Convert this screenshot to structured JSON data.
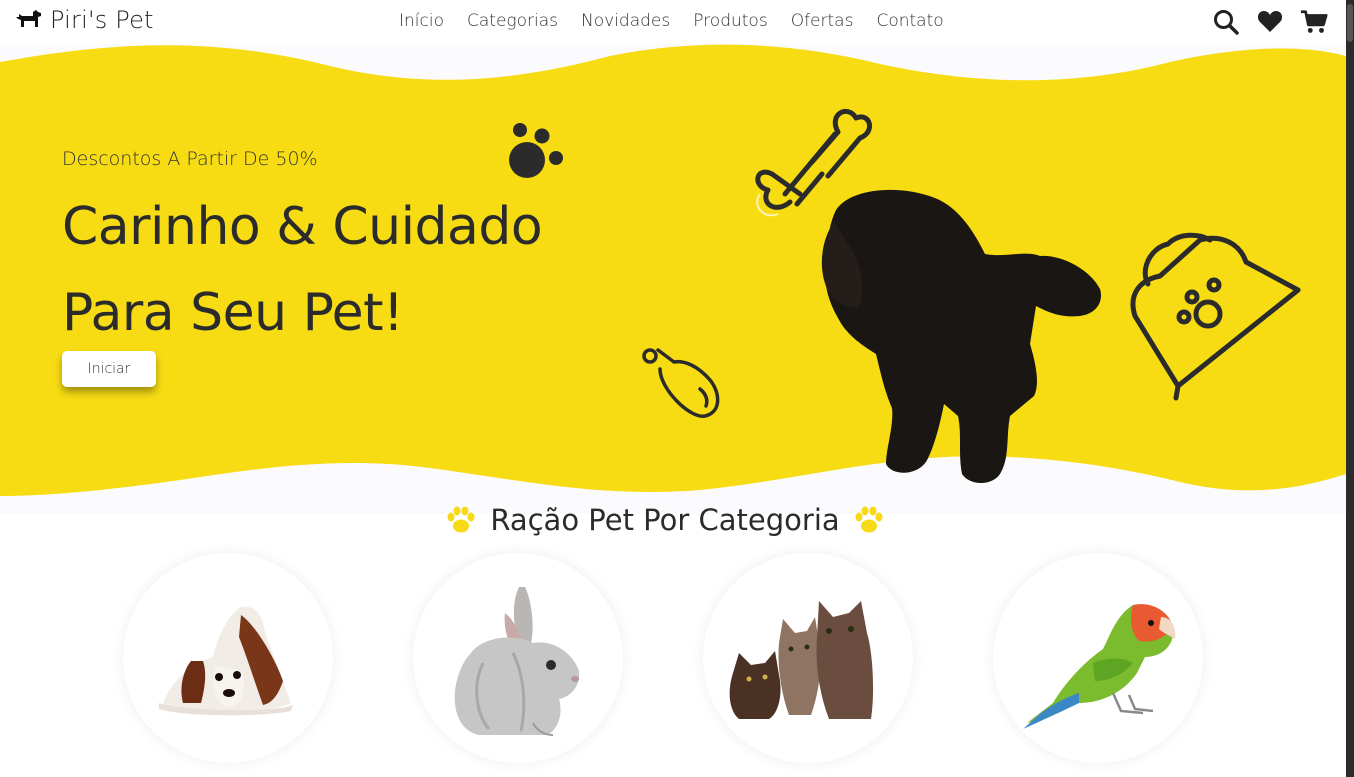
{
  "brand": {
    "name": "Piri's Pet",
    "icon": "dog-icon"
  },
  "nav": [
    "Início",
    "Categorias",
    "Novidades",
    "Produtos",
    "Ofertas",
    "Contato"
  ],
  "header_icons": [
    "search-icon",
    "heart-icon",
    "cart-icon"
  ],
  "hero": {
    "subtitle": "Descontos A Partir De 50%",
    "title_line1": "Carinho & Cuidado",
    "title_line2": "Para Seu Pet!",
    "button": "Iniciar"
  },
  "section": {
    "title": "Ração Pet Por Categoria",
    "icon": "paw-icon"
  },
  "categories": [
    "dog",
    "rabbit",
    "cats",
    "bird"
  ],
  "colors": {
    "accent": "#f7d918",
    "text": "#2b2b2b"
  }
}
